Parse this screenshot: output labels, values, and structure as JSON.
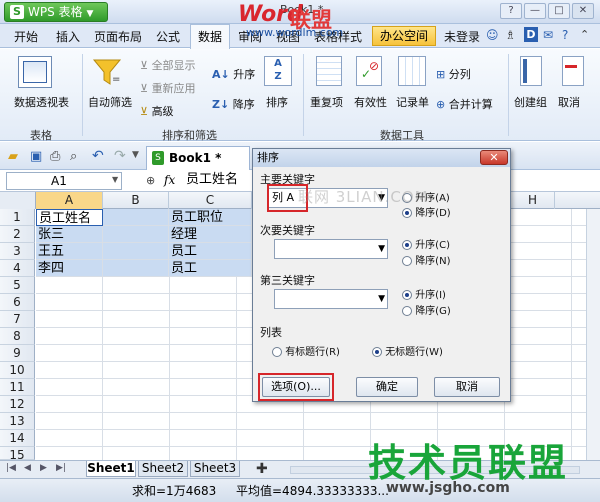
{
  "app": {
    "button_label": "WPS 表格",
    "doc_title": "Book1 *"
  },
  "window_controls": [
    "?",
    "—",
    "□",
    "✕"
  ],
  "menu": {
    "tabs": [
      "开始",
      "插入",
      "页面布局",
      "公式",
      "数据",
      "审阅",
      "视图",
      "表格样式",
      "办公空间"
    ],
    "active": "数据",
    "login": "未登录"
  },
  "ribbon": {
    "pivot": "数据透视表",
    "autofilter": "自动筛选",
    "show_all": "全部显示",
    "reapply": "重新应用",
    "advanced": "高级",
    "sort_asc": "升序",
    "sort_desc": "降序",
    "sort": "排序",
    "duplicates": "重复项",
    "validity": "有效性",
    "record": "记录单",
    "split": "分列",
    "consolidate": "合并计算",
    "group": "创建组",
    "ungroup": "取消",
    "group_table": "表格",
    "group_sortfilter": "排序和筛选",
    "group_datatools": "数据工具"
  },
  "doc_tab": "Book1 *",
  "formula": {
    "namebox": "A1",
    "fx": "fx",
    "content": "员工姓名"
  },
  "grid": {
    "columns": [
      "A",
      "B",
      "C",
      "H"
    ],
    "rows": [
      "1",
      "2",
      "3",
      "4",
      "5",
      "6",
      "7",
      "8",
      "9",
      "10",
      "11",
      "12",
      "13",
      "14",
      "15"
    ],
    "col_a": [
      "员工姓名",
      "张三",
      "王五",
      "李四"
    ],
    "col_c": [
      "员工职位",
      "经理",
      "员工",
      "员工"
    ]
  },
  "sheets": [
    "Sheet1",
    "Sheet2",
    "Sheet3"
  ],
  "status": {
    "sum": "求和=1万4683",
    "avg": "平均值=4894.33333333..."
  },
  "dialog": {
    "title": "排序",
    "key1_label": "主要关键字",
    "key1_value": "列 A",
    "key2_label": "次要关键字",
    "key3_label": "第三关键字",
    "asc1": "升序(A)",
    "desc1": "降序(D)",
    "asc2": "升序(C)",
    "desc2": "降序(N)",
    "asc3": "升序(I)",
    "desc3": "降序(G)",
    "list_label": "列表",
    "header_yes": "有标题行(R)",
    "header_no": "无标题行(W)",
    "options_btn": "选项(O)...",
    "ok_btn": "确定",
    "cancel_btn": "取消"
  },
  "watermarks": {
    "logo_a": "Word",
    "logo_b": "联盟",
    "url_top": "www.wordlm.com",
    "mid": "联网 3LIAN.COM",
    "big": "技术员联盟",
    "url_bottom": "www.jsgho.com"
  },
  "colors": {
    "accent_red": "#d6262a",
    "wps_green": "#2f9a2a",
    "selection": "#c9dbf2"
  }
}
